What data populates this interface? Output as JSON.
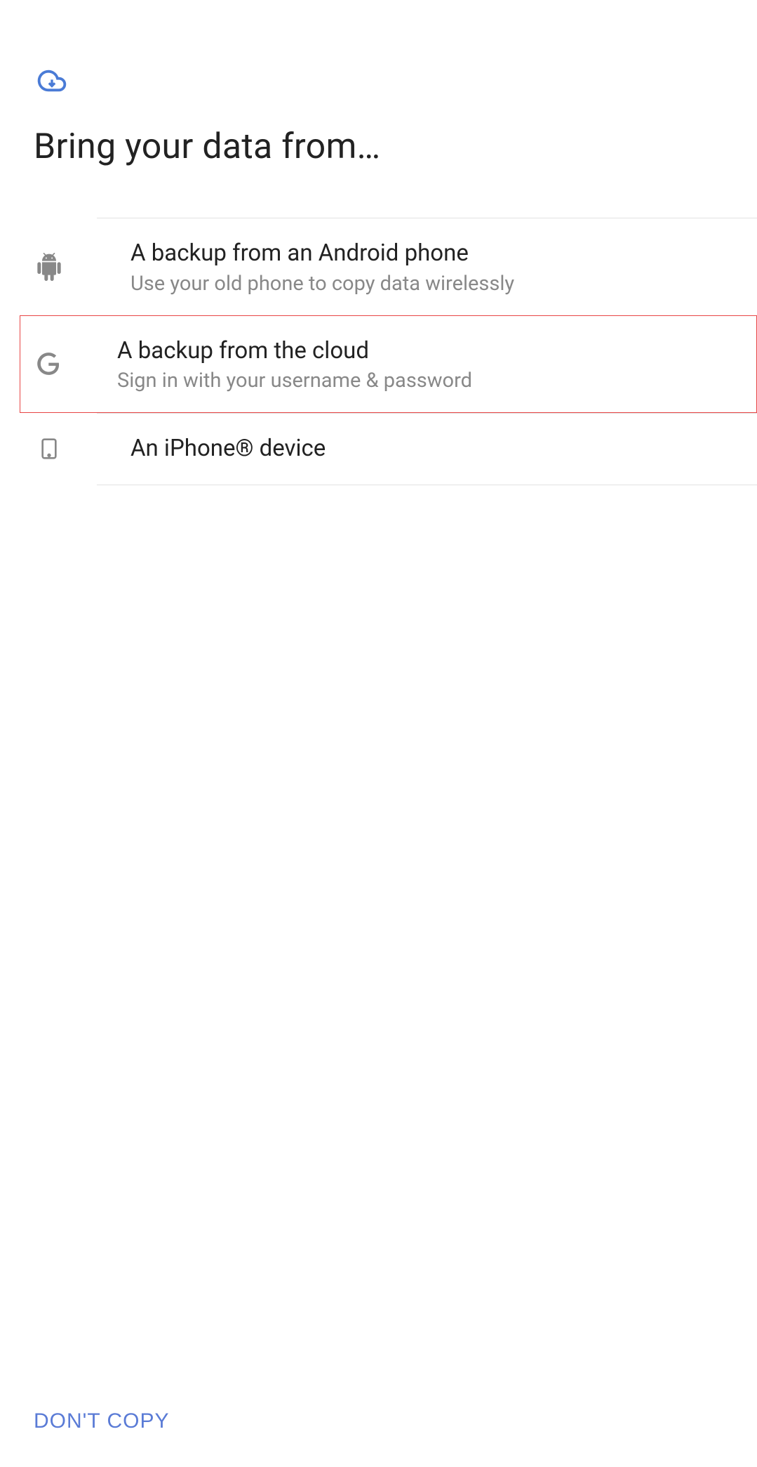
{
  "header": {
    "title": "Bring your data from…"
  },
  "options": [
    {
      "title": "A backup from an Android phone",
      "subtitle": "Use your old phone to copy data wirelessly"
    },
    {
      "title": "A backup from the cloud",
      "subtitle": "Sign in with your username & password"
    },
    {
      "title": "An iPhone® device",
      "subtitle": ""
    }
  ],
  "footer": {
    "dont_copy_label": "DON'T COPY"
  }
}
